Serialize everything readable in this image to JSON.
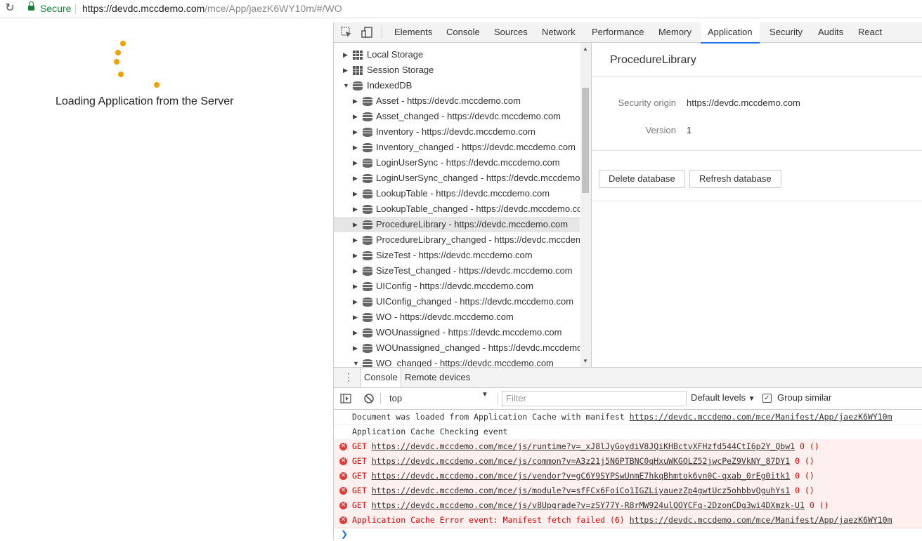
{
  "browser": {
    "secure_label": "Secure",
    "url_host": "https://devdc.mccdemo.com",
    "url_path": "/mce/App/jaezK6WY10m/#/WO",
    "reload_icon": "reload-icon",
    "lock_icon": "lock-icon"
  },
  "page": {
    "loading_text": "Loading Application from the Server"
  },
  "devtools": {
    "tabs": [
      "Elements",
      "Console",
      "Sources",
      "Network",
      "Performance",
      "Memory",
      "Application",
      "Security",
      "Audits",
      "React"
    ],
    "active_tab": "Application",
    "tree": [
      {
        "label": "Local Storage"
      },
      {
        "label": "Session Storage"
      },
      {
        "label": "IndexedDB"
      },
      {
        "label": "Asset - https://devdc.mccdemo.com"
      },
      {
        "label": "Asset_changed - https://devdc.mccdemo.com"
      },
      {
        "label": "Inventory - https://devdc.mccdemo.com"
      },
      {
        "label": "Inventory_changed - https://devdc.mccdemo.com"
      },
      {
        "label": "LoginUserSync - https://devdc.mccdemo.com"
      },
      {
        "label": "LoginUserSync_changed - https://devdc.mccdemo.com"
      },
      {
        "label": "LookupTable - https://devdc.mccdemo.com"
      },
      {
        "label": "LookupTable_changed - https://devdc.mccdemo.com"
      },
      {
        "label": "ProcedureLibrary - https://devdc.mccdemo.com"
      },
      {
        "label": "ProcedureLibrary_changed - https://devdc.mccdemo.com"
      },
      {
        "label": "SizeTest - https://devdc.mccdemo.com"
      },
      {
        "label": "SizeTest_changed - https://devdc.mccdemo.com"
      },
      {
        "label": "UIConfig - https://devdc.mccdemo.com"
      },
      {
        "label": "UIConfig_changed - https://devdc.mccdemo.com"
      },
      {
        "label": "WO - https://devdc.mccdemo.com"
      },
      {
        "label": "WOUnassigned - https://devdc.mccdemo.com"
      },
      {
        "label": "WOUnassigned_changed - https://devdc.mccdemo.com"
      },
      {
        "label": "WO_changed - https://devdc.mccdemo.com"
      }
    ],
    "selected_db": "ProcedureLibrary - https://devdc.mccdemo.com",
    "detail": {
      "title": "ProcedureLibrary",
      "security_origin_label": "Security origin",
      "security_origin_value": "https://devdc.mccdemo.com",
      "version_label": "Version",
      "version_value": "1",
      "delete_button": "Delete database",
      "refresh_button": "Refresh database"
    },
    "drawer": {
      "tabs": [
        "Console",
        "Remote devices"
      ],
      "active_tab": "Console",
      "context": "top",
      "filter_placeholder": "Filter",
      "levels": "Default levels",
      "group_similar": "Group similar",
      "group_similar_checked": true
    },
    "console": [
      {
        "type": "info",
        "text": "Document was loaded from Application Cache with manifest ",
        "link": "https://devdc.mccdemo.com/mce/Manifest/App/jaezK6WY10m",
        "suffix": ""
      },
      {
        "type": "info",
        "text": "Application Cache Checking event",
        "link": "",
        "suffix": ""
      },
      {
        "type": "error",
        "text": "GET ",
        "link": "https://devdc.mccdemo.com/mce/js/runtime?v=_xJ8lJyGoydiV8JQiKHBctvXFHzfd544CtI6p2Y_Qbw1",
        "suffix": " 0 ()"
      },
      {
        "type": "error",
        "text": "GET ",
        "link": "https://devdc.mccdemo.com/mce/js/common?v=A3z21j5N6PTBNC0qHxuWKGQLZ52jwcPeZ9VkNY_87DY1",
        "suffix": " 0 ()"
      },
      {
        "type": "error",
        "text": "GET ",
        "link": "https://devdc.mccdemo.com/mce/js/vendor?v=gC6Y9SYPSwUnmE7hkqBhmtok6vn0C-qxab_0rEg0itk1",
        "suffix": " 0 ()"
      },
      {
        "type": "error",
        "text": "GET ",
        "link": "https://devdc.mccdemo.com/mce/js/module?v=sfFCx6FoiCo1IGZLiyauezZp4gwtUcz5ohbbvQguhYs1",
        "suffix": " 0 ()"
      },
      {
        "type": "error",
        "text": "GET ",
        "link": "https://devdc.mccdemo.com/mce/js/v8Upgrade?v=zSY77Y-R8rMW924ulQOYCFq-2DzonCDg3wi4DXmzk-U1",
        "suffix": " 0 ()"
      },
      {
        "type": "error",
        "text": "Application Cache Error event: Manifest fetch failed (6) ",
        "link": "https://devdc.mccdemo.com/mce/Manifest/App/jaezK6WY10m",
        "suffix": ""
      }
    ]
  }
}
